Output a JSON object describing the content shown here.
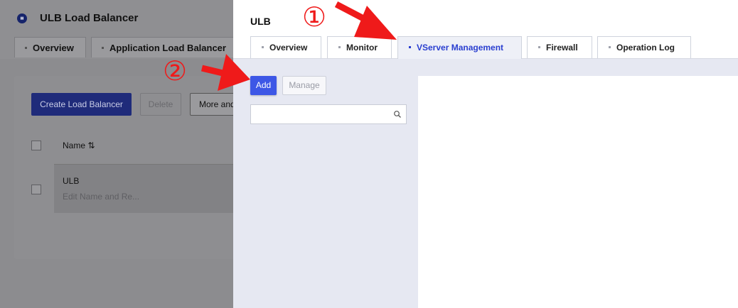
{
  "background": {
    "title": "ULB Load Balancer",
    "logo_glyph": "ᵻᵻ",
    "tabs": [
      "Overview",
      "Application Load Balancer"
    ],
    "buttons": {
      "create": "Create Load Balancer",
      "delete": "Delete",
      "more": "More and"
    },
    "table": {
      "name_header": "Name ⇅",
      "rows": [
        {
          "name": "ULB",
          "subtitle": "Edit Name and Re..."
        }
      ]
    }
  },
  "drawer": {
    "title": "ULB",
    "tabs": [
      {
        "label": "Overview",
        "active": false
      },
      {
        "label": "Monitor",
        "active": false
      },
      {
        "label": "VServer Management",
        "active": true
      },
      {
        "label": "Firewall",
        "active": false
      },
      {
        "label": "Operation Log",
        "active": false
      }
    ],
    "add_label": "Add",
    "manage_label": "Manage",
    "search": {
      "placeholder": "",
      "value": ""
    }
  },
  "annotations": {
    "step1": "①",
    "step2": "②",
    "color": "#ef1a1a"
  },
  "colors": {
    "accent": "#3d57e6",
    "active_tab_text": "#2a3fd0"
  }
}
